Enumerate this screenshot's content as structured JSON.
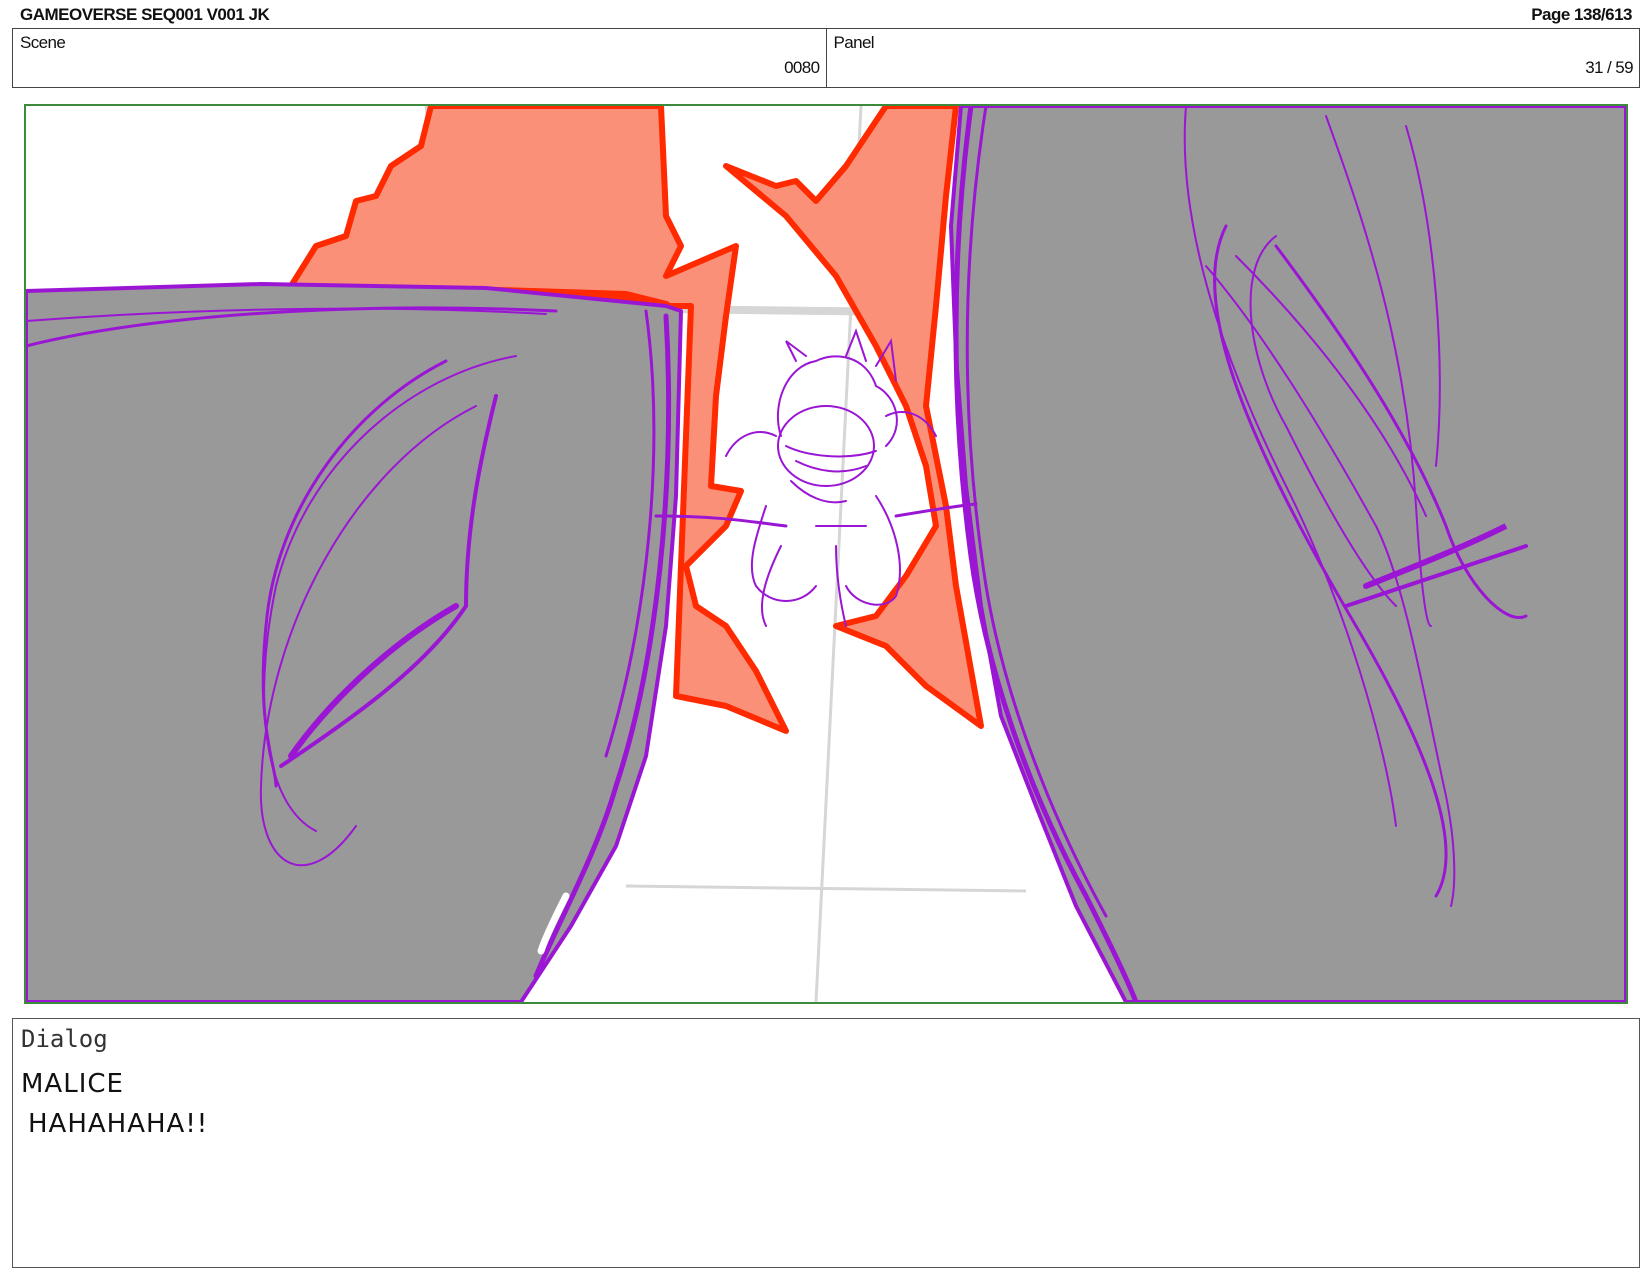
{
  "header": {
    "title": "GAMEOVERSE SEQ001 V001 JK",
    "page": "Page 138/613"
  },
  "info": {
    "scene_label": "Scene",
    "scene_value": "0080",
    "panel_label": "Panel",
    "panel_value": "31 / 59"
  },
  "dialog": {
    "label": "Dialog",
    "speaker": "MALICE",
    "line": "HAHAHAHA!!"
  },
  "colors": {
    "frame_border": "#3c8a3c",
    "gray_fill": "#999999",
    "purple_line": "#9a16d4",
    "red_line": "#ff2a00",
    "salmon_fill": "#fb9079"
  }
}
